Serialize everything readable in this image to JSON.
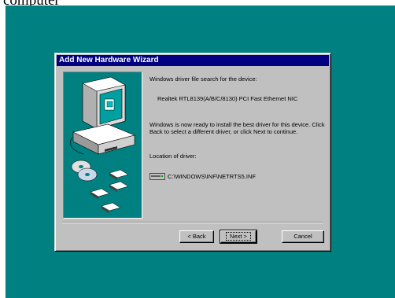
{
  "page_top_text": "computer",
  "dialog": {
    "title": "Add New Hardware Wizard",
    "search_label": "Windows driver file search for the device:",
    "device_name": "Realtek RTL8139(A/B/C/8130) PCI Fast Ethernet NIC",
    "ready_text": "Windows is now ready to install the best driver for this device. Click Back to select a different driver, or click Next to continue.",
    "location_label": "Location of driver:",
    "driver_path": "C:\\WINDOWS\\INF\\NETRTS5.INF",
    "buttons": {
      "back": "< Back",
      "next": "Next >",
      "cancel": "Cancel"
    }
  },
  "colors": {
    "desktop": "#008080",
    "titlebar": "#000080",
    "dialog_face": "#c0c0c0"
  },
  "icons": [
    "computer-icon",
    "cd-icon",
    "floppy-disk-icon",
    "drive-icon"
  ]
}
